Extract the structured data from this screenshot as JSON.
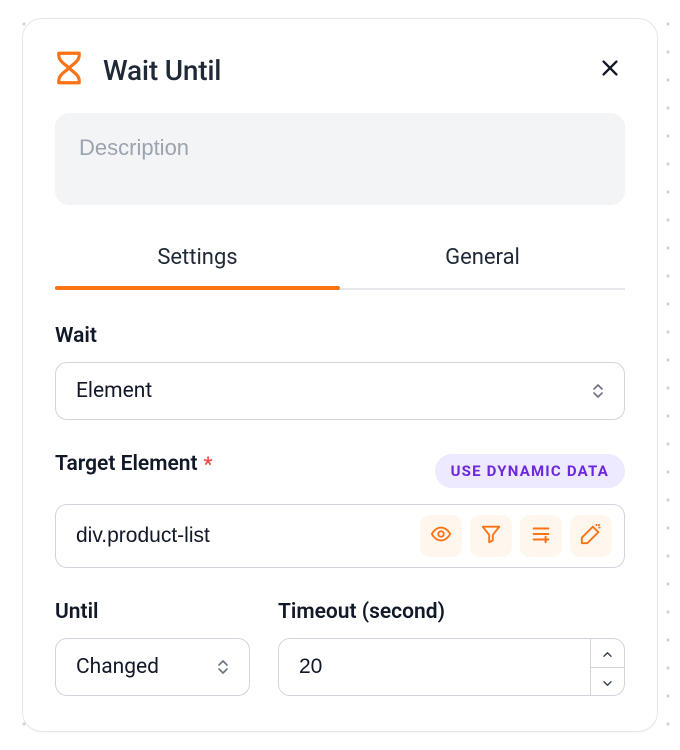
{
  "header": {
    "title": "Wait Until",
    "icon": "hourglass-icon"
  },
  "description": {
    "placeholder": "Description",
    "value": ""
  },
  "tabs": {
    "items": [
      {
        "label": "Settings",
        "active": true
      },
      {
        "label": "General",
        "active": false
      }
    ]
  },
  "fields": {
    "wait": {
      "label": "Wait",
      "value": "Element"
    },
    "target": {
      "label": "Target Element",
      "required": true,
      "dynamic_badge": "USE DYNAMIC DATA",
      "value": "div.product-list"
    },
    "until": {
      "label": "Until",
      "value": "Changed"
    },
    "timeout": {
      "label": "Timeout (second)",
      "value": "20"
    }
  }
}
